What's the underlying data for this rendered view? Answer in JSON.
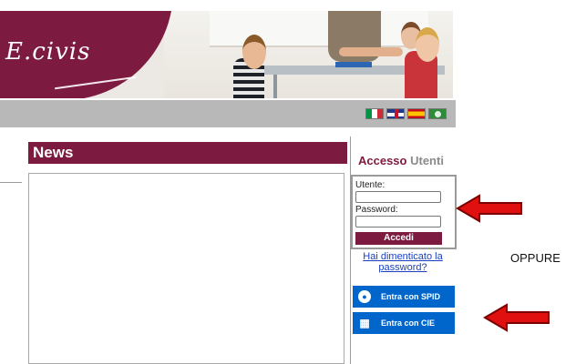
{
  "header": {
    "logo_text": "E.civis"
  },
  "languages": [
    "Italiano",
    "English",
    "Español",
    "Ladin"
  ],
  "news": {
    "title": "News"
  },
  "login": {
    "title_part1": "Accesso",
    "title_part2": "Utenti",
    "user_label": "Utente:",
    "user_value": "",
    "password_label": "Password:",
    "password_value": "",
    "submit_label": "Accedi",
    "forgot_label": "Hai dimenticato la password?"
  },
  "spid": {
    "label": "Entra con SPID"
  },
  "cie": {
    "label": "Entra con CIE"
  },
  "annotation": {
    "oppure": "OPPURE"
  },
  "colors": {
    "brand": "#7d1a3f",
    "nav": "#b8b8b8",
    "spid_blue": "#0066cc",
    "arrow_red": "#e01010"
  }
}
